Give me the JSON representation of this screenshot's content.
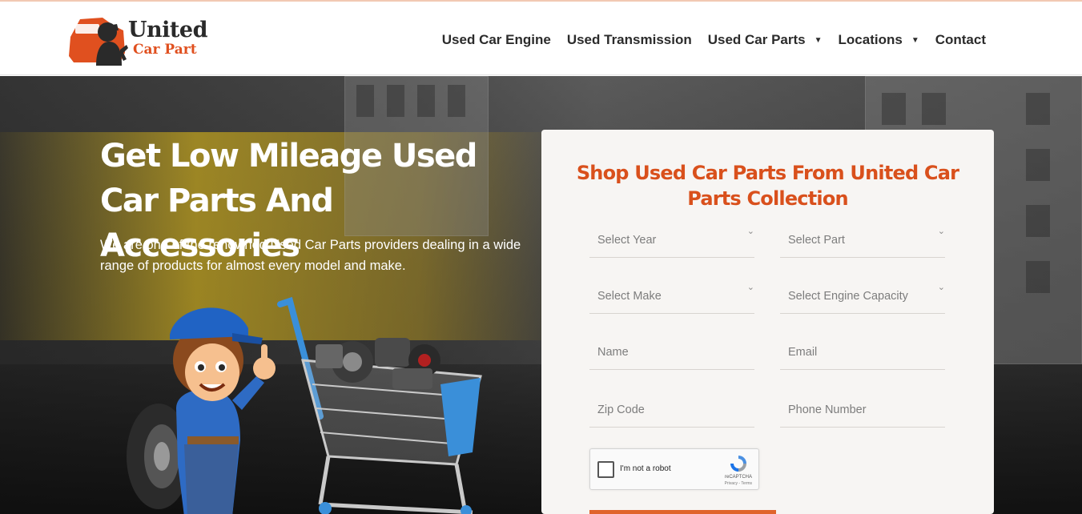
{
  "logo": {
    "line1": "United",
    "line2": "Car Part"
  },
  "nav": {
    "items": [
      {
        "label": "Used Car Engine"
      },
      {
        "label": "Used Transmission"
      },
      {
        "label": "Used Car Parts",
        "has_dropdown": true
      },
      {
        "label": "Locations",
        "has_dropdown": true
      },
      {
        "label": "Contact"
      }
    ]
  },
  "hero": {
    "title": "Get Low Mileage Used Car Parts And Accessories",
    "description": "We are one of the renowned Used Car Parts providers dealing in a wide range of products for almost every model and make."
  },
  "form": {
    "title": "Shop Used Car Parts From United Car Parts Collection",
    "select_year": "Select Year",
    "select_part": "Select Part",
    "select_make": "Select Make",
    "select_engine": "Select Engine Capacity",
    "name_placeholder": "Name",
    "email_placeholder": "Email",
    "zip_placeholder": "Zip Code",
    "phone_placeholder": "Phone Number",
    "captcha_label": "I'm not a robot",
    "captcha_brand": "reCAPTCHA",
    "captcha_terms": "Privacy - Terms"
  },
  "colors": {
    "accent": "#d9501c",
    "nav_text": "#2b2b2b",
    "panel_bg": "#f7f5f3"
  }
}
